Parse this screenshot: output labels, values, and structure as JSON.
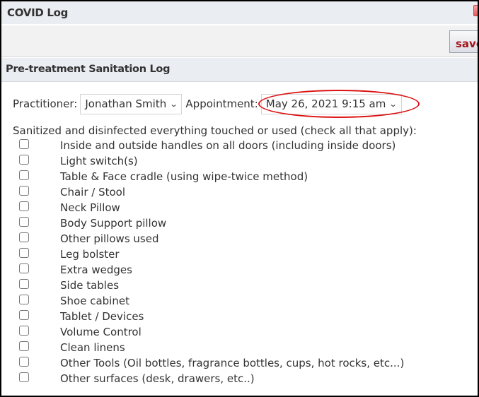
{
  "window": {
    "title": "COVID Log",
    "close_icon": "close-icon",
    "save_label": "save"
  },
  "section": {
    "title": "Pre-treatment Sanitation Log"
  },
  "form": {
    "practitioner_label": "Practitioner:",
    "practitioner_value": "Jonathan Smith",
    "appointment_label": "Appointment:",
    "appointment_value": "May 26, 2021 9:15 am",
    "dropdown_icon": "⌵",
    "instructions": "Sanitized and disinfected everything touched or used (check all that apply):",
    "items": [
      {
        "label": "Inside and outside handles on all doors (including inside doors)",
        "checked": false
      },
      {
        "label": "Light switch(s)",
        "checked": false
      },
      {
        "label": "Table & Face cradle (using wipe-twice method)",
        "checked": false
      },
      {
        "label": "Chair / Stool",
        "checked": false
      },
      {
        "label": "Neck Pillow",
        "checked": false
      },
      {
        "label": "Body Support pillow",
        "checked": false
      },
      {
        "label": "Other pillows used",
        "checked": false
      },
      {
        "label": "Leg bolster",
        "checked": false
      },
      {
        "label": "Extra wedges",
        "checked": false
      },
      {
        "label": "Side tables",
        "checked": false
      },
      {
        "label": "Shoe cabinet",
        "checked": false
      },
      {
        "label": "Tablet / Devices",
        "checked": false
      },
      {
        "label": "Volume Control",
        "checked": false
      },
      {
        "label": "Clean linens",
        "checked": false
      },
      {
        "label": "Other Tools (Oil bottles, fragrance bottles, cups, hot rocks, etc...)",
        "checked": false
      },
      {
        "label": "Other surfaces (desk, drawers, etc..)",
        "checked": false
      }
    ]
  },
  "annotation": {
    "highlight_color": "#dd1111"
  }
}
